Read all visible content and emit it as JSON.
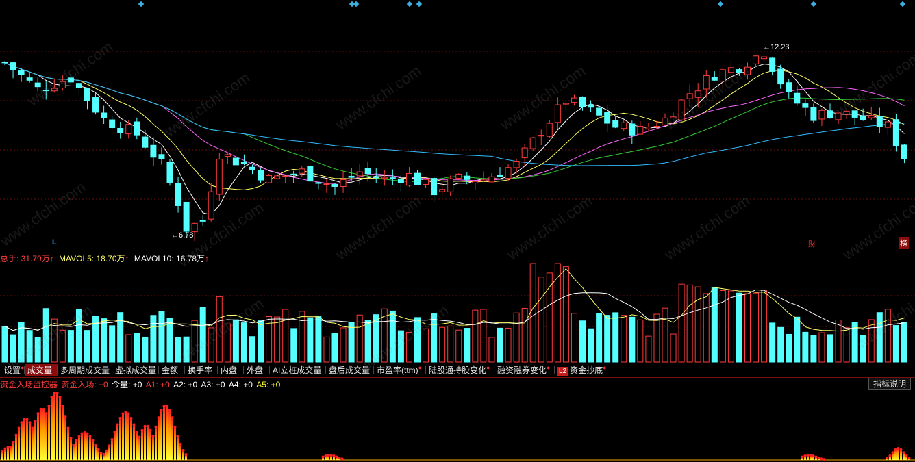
{
  "price": {
    "high_label": "12.23",
    "low_label": "6.78",
    "l_marker": "L",
    "cai_marker": "财",
    "bang_marker": "榜"
  },
  "volume": {
    "total_label": "总手: 31.79万",
    "mavol5_label": "MAVOL5: 18.70万",
    "mavol10_label": "MAVOL10: 16.78万",
    "arrow": "↑"
  },
  "tabs": [
    {
      "label": "设置",
      "dot": true,
      "active": false
    },
    {
      "label": "成交量",
      "dot": false,
      "active": true
    },
    {
      "label": "多周期成交量",
      "dot": false,
      "active": false
    },
    {
      "label": "虚拟成交量",
      "dot": false,
      "active": false
    },
    {
      "label": "金额",
      "dot": false,
      "active": false
    },
    {
      "label": "换手率",
      "dot": false,
      "active": false
    },
    {
      "label": "内盘",
      "dot": false,
      "active": false
    },
    {
      "label": "外盘",
      "dot": false,
      "active": false
    },
    {
      "label": "AI立桩成交量",
      "dot": false,
      "active": false
    },
    {
      "label": "盘后成交量",
      "dot": false,
      "active": false
    },
    {
      "label": "市盈率(ttm)",
      "dot": true,
      "active": false
    },
    {
      "label": "陆股通持股变化",
      "dot": true,
      "active": false
    },
    {
      "label": "融资融券变化",
      "dot": true,
      "active": false
    },
    {
      "label": "资金抄底",
      "dot": true,
      "active": false,
      "badge": "L2"
    }
  ],
  "fund": {
    "title": "资金入场监控器",
    "entry": "资金入场: +0",
    "today": "今量: +0",
    "a1": "A1: +0",
    "a2": "A2: +0",
    "a3": "A3: +0",
    "a4": "A4: +0",
    "a5": "A5: +0",
    "help": "指标说明"
  },
  "watermark": "www.cfchi.com",
  "colors": {
    "up": "#ff3b3b",
    "down": "#54ffff",
    "ma5": "#ffffff",
    "ma10": "#ffff66",
    "ma20": "#ff66ff",
    "ma30": "#33cc33",
    "ma60": "#33bbff",
    "grid": "#6a0e0e"
  }
}
